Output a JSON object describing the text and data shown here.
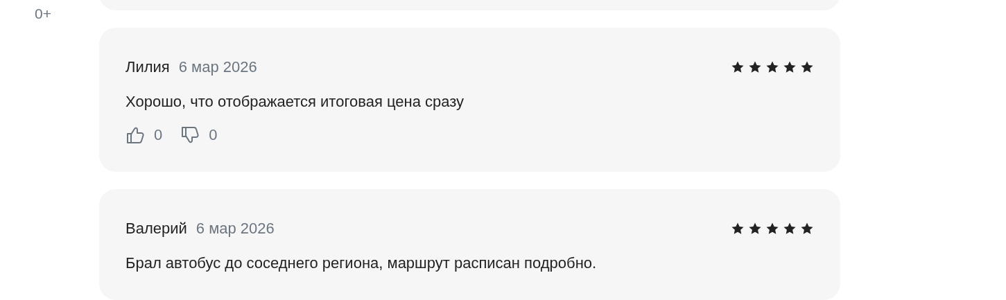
{
  "age_rating": "0+",
  "reviews": [
    {
      "author": "Лилия",
      "date": "6 мар 2026",
      "stars": 5,
      "text": "Хорошо, что отображается итоговая цена сразу",
      "likes": "0",
      "dislikes": "0"
    },
    {
      "author": "Валерий",
      "date": "6 мар 2026",
      "stars": 5,
      "text": "Брал автобус до соседнего региона, маршрут расписан подробно."
    }
  ]
}
